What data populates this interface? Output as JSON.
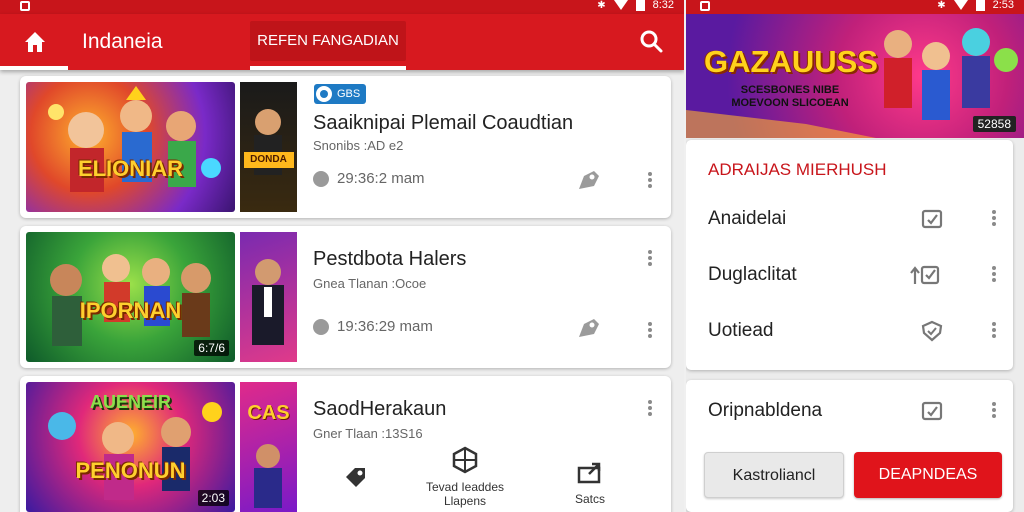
{
  "colors": {
    "brand_red": "#d7191f",
    "accent_blue": "#1e7ac4",
    "banner_yellow": "#ffd21c"
  },
  "left_phone": {
    "status_time": "8:32",
    "appbar": {
      "title": "Indaneia",
      "tab_label": "REFEN FANGADIAN",
      "home_icon": "home-icon",
      "search_icon": "search-icon"
    },
    "cards": [
      {
        "thumb_text": "ELIONIAR",
        "side_text": "DONDA",
        "badge": "GBS",
        "title": "Saaiknipai Plemail Coaudtian",
        "subtitle": "Snonibs :AD e2",
        "time": "29:36:2 mam",
        "duration": ""
      },
      {
        "thumb_text": "IPORNAN",
        "side_text": "",
        "badge": "",
        "title": "Pestdbota Halers",
        "subtitle": "Gnea Tlanan :Ocoe",
        "time": "19:36:29 mam",
        "duration": "6:7/6"
      },
      {
        "thumb_text": "PENONUN",
        "thumb_text_top": "AUENEIR",
        "side_text": "CAS",
        "badge": "",
        "title": "SaodHerakaun",
        "subtitle": "Gner Tlaan :13S16",
        "time": "",
        "duration": "2:03"
      }
    ],
    "actions": [
      {
        "label": "",
        "icon": "tag-icon"
      },
      {
        "label": "Tevad Ieaddes\nLlapens",
        "icon": "hex-icon"
      },
      {
        "label": "Satcs",
        "icon": "export-icon"
      }
    ]
  },
  "right_phone": {
    "status_time": "2:53",
    "banner": {
      "title": "GAZAUUSS",
      "subtitle": "SCESBONES NIBE\nMOEVOON SLICOEAN",
      "count": "52858"
    },
    "panel": {
      "heading": "ADRAIJAS MIERHUSH",
      "items": [
        {
          "label": "Anaidelai",
          "icon": "checkbox-icon"
        },
        {
          "label": "Duglaclitat",
          "icon": "upload-check-icon"
        },
        {
          "label": "Uotiead",
          "icon": "shield-check-icon"
        }
      ]
    },
    "bottom": {
      "item_label": "Oripnabldena",
      "item_icon": "checkbox-icon",
      "cancel_label": "Kastroliancl",
      "confirm_label": "DEAPNDEAS"
    }
  }
}
